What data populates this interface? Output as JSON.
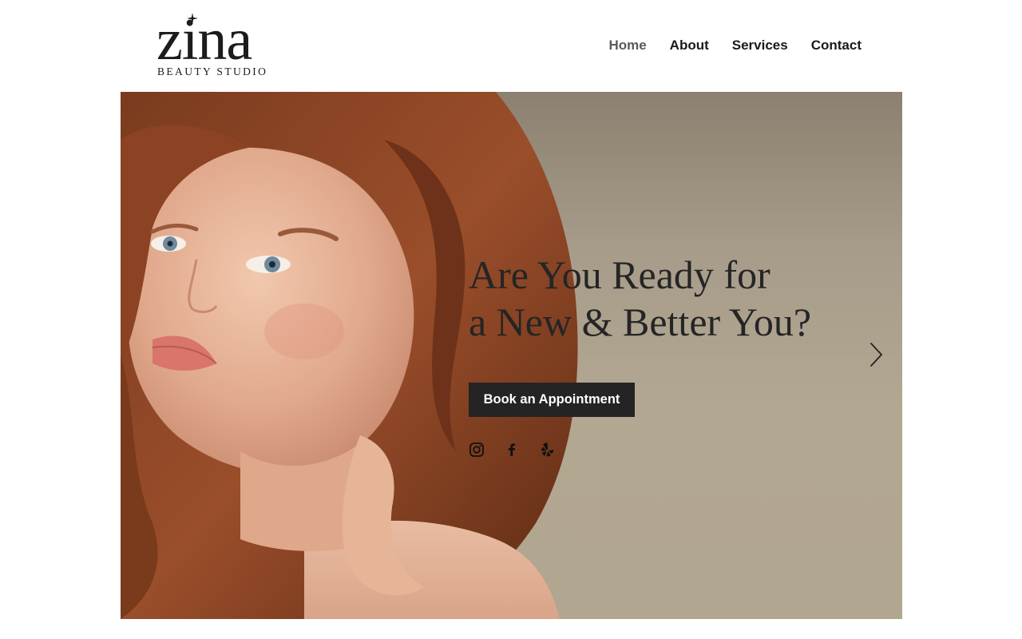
{
  "logo": {
    "wordmark": "zina",
    "subtitle": "BEAUTY STUDIO",
    "ornament_icon": "four-point-star-icon"
  },
  "nav": {
    "items": [
      {
        "label": "Home",
        "active": true
      },
      {
        "label": "About",
        "active": false
      },
      {
        "label": "Services",
        "active": false
      },
      {
        "label": "Contact",
        "active": false
      }
    ]
  },
  "hero": {
    "headline_line1": "Are You Ready for",
    "headline_line2": "a New & Better You?",
    "cta_label": "Book an Appointment",
    "photo_icon": "portrait-photo",
    "next_icon": "chevron-right-icon",
    "social_icons": [
      "instagram-icon",
      "facebook-icon",
      "yelp-icon"
    ]
  },
  "colors": {
    "accent_dark": "#242424",
    "hero_background": "#b1a690",
    "nav_active": "#5a5a5a",
    "text_dark": "#1a1a1a"
  }
}
